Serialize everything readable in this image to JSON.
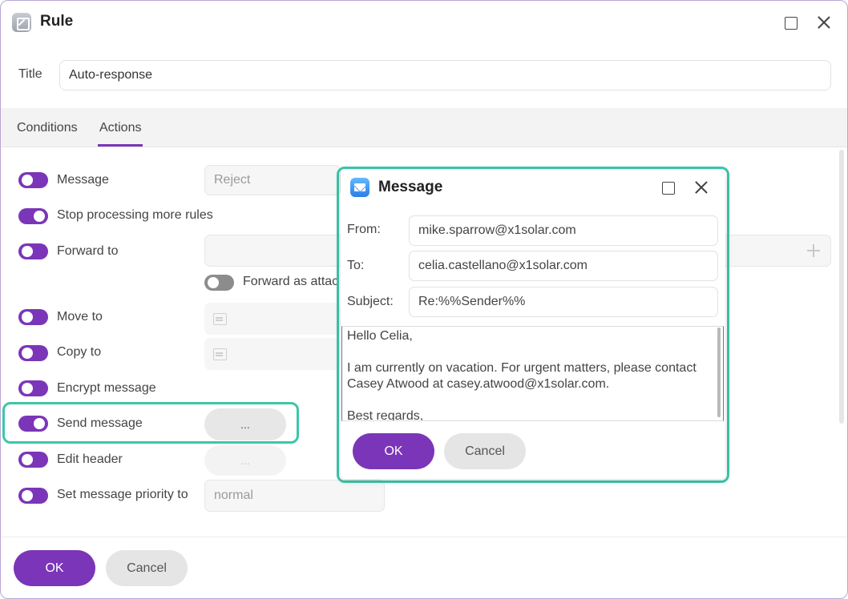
{
  "window": {
    "title": "Rule"
  },
  "rule": {
    "title_label": "Title",
    "title_value": "Auto-response"
  },
  "tabs": [
    {
      "label": "Conditions"
    },
    {
      "label": "Actions"
    }
  ],
  "actions": {
    "message": {
      "label": "Message",
      "value": "Reject"
    },
    "stop_processing": {
      "label": "Stop processing more rules"
    },
    "forward_to": {
      "label": "Forward to",
      "attach_label": "Forward as attac"
    },
    "move_to": {
      "label": "Move to"
    },
    "copy_to": {
      "label": "Copy to"
    },
    "encrypt": {
      "label": "Encrypt message"
    },
    "send_message": {
      "label": "Send message",
      "button": "..."
    },
    "edit_header": {
      "label": "Edit header",
      "button": "..."
    },
    "priority": {
      "label": "Set message priority to",
      "value": "normal"
    }
  },
  "footer": {
    "ok": "OK",
    "cancel": "Cancel"
  },
  "dialog": {
    "title": "Message",
    "from_label": "From:",
    "from_value": "mike.sparrow@x1solar.com",
    "to_label": "To:",
    "to_value": "celia.castellano@x1solar.com",
    "subject_label": "Subject:",
    "subject_value": "Re:%%Sender%%",
    "body_value": "Hello Celia,\n\nI am currently on vacation. For urgent matters, please contact Casey Atwood at casey.atwood@x1solar.com.\n\nBest regards,",
    "ok": "OK",
    "cancel": "Cancel"
  },
  "colors": {
    "accent": "#7b35b8",
    "highlight": "#3cc6a9"
  }
}
